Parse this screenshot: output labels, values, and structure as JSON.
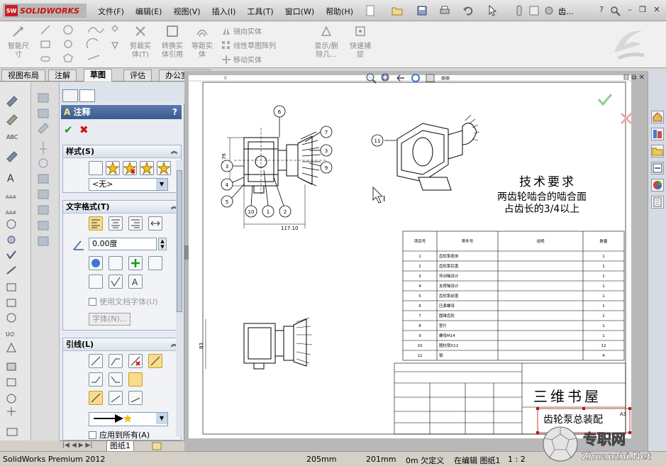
{
  "app": {
    "brand": "SOLIDWORKS",
    "doc_title": "齿...",
    "help": "?"
  },
  "menu": [
    "文件(F)",
    "编辑(E)",
    "视图(V)",
    "插入(I)",
    "工具(T)",
    "窗口(W)",
    "帮助(H)"
  ],
  "command_manager": {
    "smart_dim": "智能尺\n寸",
    "trim": "剪裁实\n体(T)",
    "convert": "转换实\n体引用",
    "offset": "等距实\n体",
    "mirror": "镜向实体",
    "linear_pattern": "线性草图阵列",
    "move": "移动实体",
    "show_hide": "显示/删\n除几...",
    "quick_snap": "快速捕\n捉"
  },
  "tabs": [
    "视图布局",
    "注解",
    "草图",
    "评估",
    "办公室产品"
  ],
  "active_tab": "草图",
  "property_manager": {
    "title": "注释",
    "help": "?",
    "style_group": {
      "title": "样式(S)",
      "style_value": "<无>"
    },
    "text_format_group": {
      "title": "文字格式(T)",
      "angle_value": "0.00度",
      "use_doc_font": "使用文档字体(U)",
      "font_button": "字体(N)..."
    },
    "leader_group": {
      "title": "引线(L)",
      "apply_all": "应用到所有(A)"
    }
  },
  "sheet_tab": "图纸1",
  "drawing": {
    "tech_title": "技术要求",
    "tech_line1": "两齿轮啮合的啮合面",
    "tech_line2": "占齿长的3/4以上",
    "dim_width": "117.10",
    "dim_height": "84.76",
    "dim_small": "83",
    "balloons": [
      "6",
      "7",
      "3",
      "9",
      "3",
      "4",
      "5",
      "10",
      "1",
      "2",
      "11"
    ],
    "bom_headers": [
      "项目号",
      "零件号",
      "说明",
      "数量"
    ],
    "bom_rows": [
      [
        "1",
        "齿轮泵座体",
        "",
        "1"
      ],
      [
        "2",
        "齿轮泵后盖",
        "",
        "1"
      ],
      [
        "3",
        "传动轴设计",
        "",
        "1"
      ],
      [
        "4",
        "支撑轴设计",
        "",
        "1"
      ],
      [
        "5",
        "齿轮泵前盖",
        "",
        "1"
      ],
      [
        "6",
        "压紧螺母",
        "",
        "1"
      ],
      [
        "7",
        "圆锥齿轮",
        "",
        "1"
      ],
      [
        "8",
        "垫片",
        "",
        "1"
      ],
      [
        "9",
        "螺母M14",
        "",
        "1"
      ],
      [
        "10",
        "圆柱销X12",
        "",
        "12"
      ],
      [
        "11",
        "销",
        "",
        "4"
      ]
    ],
    "company": "三维书屋",
    "part_name": "齿轮泵总装配",
    "sheet_size": "A3"
  },
  "status": {
    "product": "SolidWorks Premium 2012",
    "x": "205mm",
    "y": "201mm",
    "state": "0m 欠定义",
    "editing": "在编辑 图纸1",
    "scale": "1 : 2"
  },
  "watermark": {
    "text1": "专职网",
    "text2": "Zhuanzhi.Net"
  },
  "colors": {
    "pm_header": "#3a5a8c",
    "ok_green": "#1a9a1a",
    "cancel_red": "#d01010",
    "brand_red": "#c8202a"
  }
}
